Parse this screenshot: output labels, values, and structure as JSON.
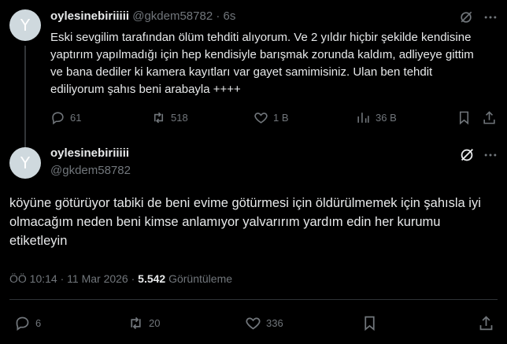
{
  "post1": {
    "avatar_letter": "Y",
    "name": "oylesinebiriiiii",
    "handle": "@gkdem58782",
    "time": "6s",
    "text": "Eski sevgilim tarafından ölüm tehditi alıyorum. Ve 2 yıldır hiçbir şekilde kendisine yaptırım yapılmadığı için hep kendisiyle barışmak zorunda kaldım, adliyeye gittim ve bana dediler ki kamera kayıtları var gayet samimisiniz. Ulan ben tehdit ediliyorum şahıs beni arabayla ++++",
    "replies": "61",
    "reposts": "518",
    "likes": "1 B",
    "views": "36 B"
  },
  "post2": {
    "avatar_letter": "Y",
    "name": "oylesinebiriiiii",
    "handle": "@gkdem58782",
    "text": "köyüne götürüyor tabiki de beni evime götürmesi için öldürülmemek için şahısla iyi olmacağım neden beni kimse anlamıyor yalvarırım yardım edin her kurumu etiketleyin",
    "timestamp": "ÖÖ 10:14 · 11 Mar 2026 · ",
    "view_count": "5.542",
    "views_label": " Görüntüleme",
    "replies": "6",
    "reposts": "20",
    "likes": "336"
  },
  "colors": {
    "background": "#000000",
    "text": "#e7e9ea",
    "muted": "#71767b",
    "divider": "#2f3336",
    "avatar": "#cfd9de"
  }
}
